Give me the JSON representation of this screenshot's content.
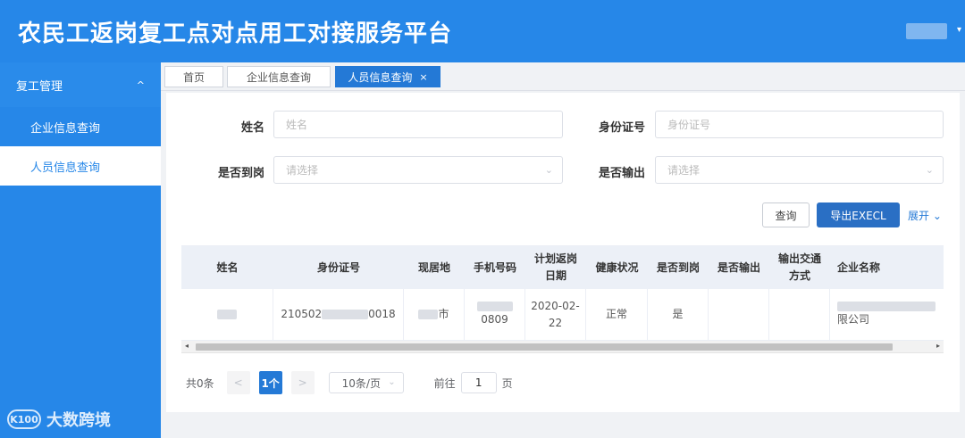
{
  "header": {
    "title": "农民工返岗复工点对点用工对接服务平台",
    "caret": "▾"
  },
  "sidebar": {
    "group": {
      "label": "复工管理",
      "chevron": "^"
    },
    "items": [
      {
        "label": "企业信息查询",
        "active": false
      },
      {
        "label": "人员信息查询",
        "active": true
      }
    ],
    "watermark": "大数跨境",
    "watermark_logo": "K100"
  },
  "tabs": [
    {
      "label": "首页"
    },
    {
      "label": "企业信息查询"
    },
    {
      "label": "人员信息查询",
      "close": "×"
    }
  ],
  "form": {
    "name": {
      "label": "姓名",
      "placeholder": "姓名"
    },
    "id": {
      "label": "身份证号",
      "placeholder": "身份证号"
    },
    "onduty": {
      "label": "是否到岗",
      "placeholder": "请选择"
    },
    "export_out": {
      "label": "是否输出",
      "placeholder": "请选择"
    },
    "chevron": "⌄"
  },
  "actions": {
    "query": "查询",
    "export": "导出EXECL",
    "expand": "展开 ⌄"
  },
  "table": {
    "headers": [
      "姓名",
      "身份证号",
      "现居地",
      "手机号码",
      "计划返岗日期",
      "健康状况",
      "是否到岗",
      "是否输出",
      "输出交通方式",
      "企业名称"
    ],
    "header_lines": {
      "plan_date": [
        "计划返岗",
        "日期"
      ],
      "transport": [
        "输出交通",
        "方式"
      ]
    },
    "row": {
      "id_prefix": "210502",
      "id_suffix": "0018",
      "city": "市",
      "phone_tail": "0809",
      "date_line1": "2020-02-",
      "date_line2": "22",
      "health": "正常",
      "onduty": "是",
      "company_tail": "限公司"
    },
    "scroll_left": "◂",
    "scroll_right": "▸"
  },
  "pagination": {
    "total": "共0条",
    "prev": "<",
    "current": "1个",
    "next": ">",
    "page_size": "10条/页",
    "goto": "前往",
    "goto_value": "1",
    "page_unit": "页",
    "chevron": "⌄"
  },
  "colors": {
    "primary": "#2687e8",
    "button": "#2a6fc4"
  }
}
